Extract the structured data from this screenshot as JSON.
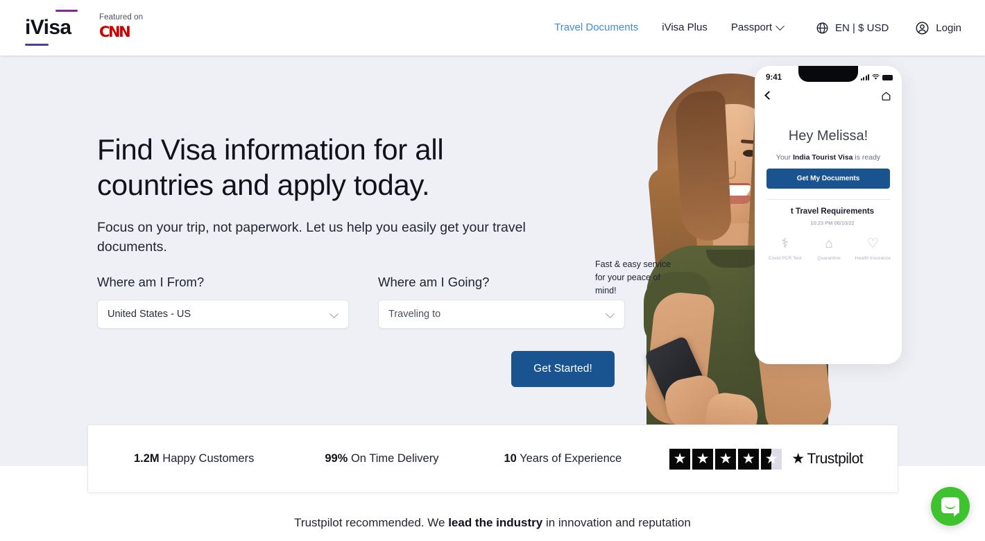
{
  "header": {
    "logo_text": "iVisa",
    "featured_label": "Featured on",
    "featured_brand": "CNN",
    "nav": [
      {
        "label": "Travel Documents",
        "active": true
      },
      {
        "label": "iVisa Plus",
        "active": false
      },
      {
        "label": "Passport",
        "active": false,
        "has_caret": true
      }
    ],
    "locale": {
      "icon": "globe-icon",
      "text": "EN  |  $ USD"
    },
    "login": {
      "icon": "user-circle-icon",
      "label": "Login"
    }
  },
  "hero": {
    "headline": "Find Visa information for all countries and apply today.",
    "subheadline": "Focus on your trip, not paperwork. Let us help you easily get your travel documents.",
    "form": {
      "from": {
        "label": "Where am I From?",
        "value": "United States - US",
        "is_placeholder": false
      },
      "to": {
        "label": "Where am I Going?",
        "value": "Traveling to",
        "is_placeholder": true
      },
      "cta_label": "Get Started!"
    },
    "artwork": {
      "tagline": "Fast & easy service for your peace of mind!",
      "phone": {
        "time": "9:41",
        "greeting": "Hey Melissa!",
        "subtitle_pre": "Your ",
        "subtitle_bold": "India Tourist Visa",
        "subtitle_post": " is ready",
        "button_label": "Get My Documents",
        "requirements_title": "t Travel Requirements",
        "requirements_time": "10:23 PM 06/10/22",
        "requirement_items": [
          {
            "icon": "syringe-icon",
            "glyph": "⚕",
            "label": "Covid PCR Test"
          },
          {
            "icon": "house-icon",
            "glyph": "⌂",
            "label": "Quarantine"
          },
          {
            "icon": "heart-shield-icon",
            "glyph": "♡",
            "label": "Health Insurance"
          }
        ]
      }
    }
  },
  "stats": {
    "items": [
      {
        "value": "1.2M",
        "label": " Happy Customers"
      },
      {
        "value": "99%",
        "label": " On Time Delivery"
      },
      {
        "value": "10",
        "label": " Years of Experience"
      }
    ],
    "trustpilot": {
      "brand": "Trustpilot",
      "rating": 4.5,
      "max_stars": 5,
      "star_glyph": "★"
    }
  },
  "footer_note": {
    "pre": "Trustpilot recommended. We ",
    "bold": "lead the industry",
    "post": " in innovation and reputation"
  },
  "chat": {
    "icon": "chat-bubble-icon",
    "color": "#3ec22e"
  },
  "colors": {
    "hero_bg": "#eff0f5",
    "accent_blue": "#1a5490",
    "nav_active": "#3f8ddb",
    "logo_purple_top": "#7b2d8e",
    "logo_purple_bottom": "#4a3f9e",
    "cnn_red": "#cc0000",
    "star_filled": "#080808",
    "star_empty": "#dcdce6"
  }
}
